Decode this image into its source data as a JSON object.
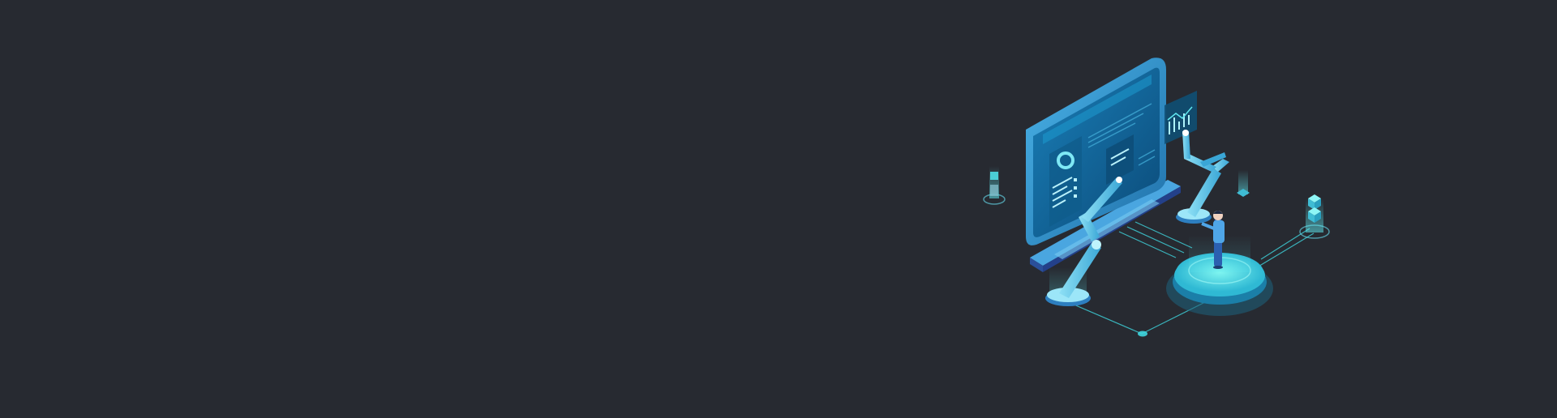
{
  "banner": {
    "background_color": "#272a31",
    "accent_color": "#3fd6df",
    "illustration": {
      "icon": "isometric-monitor-robot-arms-icon"
    }
  }
}
